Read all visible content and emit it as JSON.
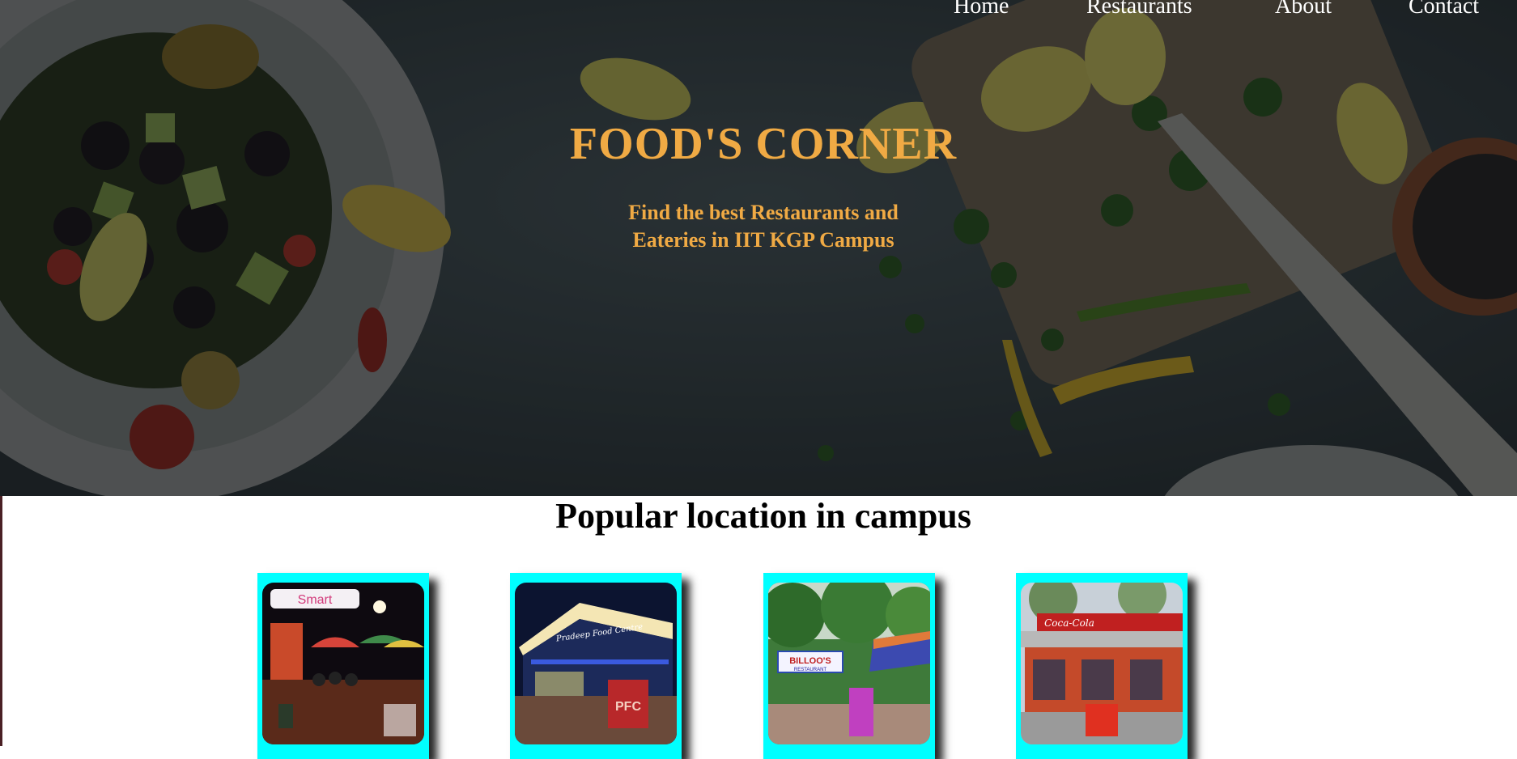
{
  "nav": {
    "home": "Home",
    "restaurants": "Restaurants",
    "about": "About",
    "contact": "Contact"
  },
  "hero": {
    "title": "FOOD'S CORNER",
    "subtitle": "Find the best Restaurants and Eateries in IIT KGP Campus"
  },
  "popular": {
    "heading": "Popular location in campus",
    "cards": [
      {
        "sign": "Smart"
      },
      {
        "sign": "Pradeep Food Centre",
        "badge": "PFC"
      },
      {
        "sign": "BILLOO'S",
        "sign2": "RESTAURANT"
      },
      {
        "sign": "Coca-Cola"
      }
    ]
  },
  "colors": {
    "accent": "#f0aa44",
    "card_frame": "#00ffff"
  }
}
